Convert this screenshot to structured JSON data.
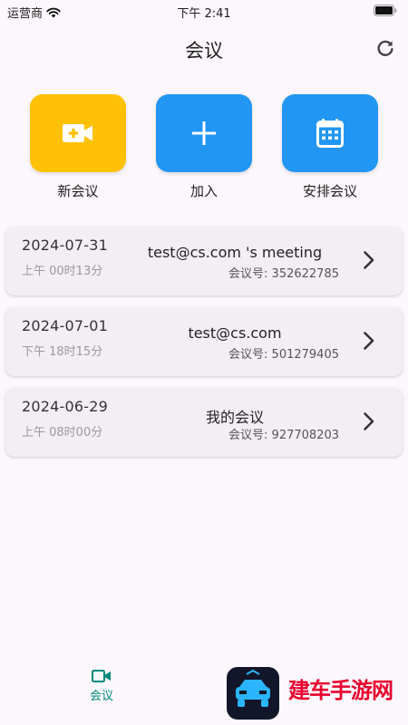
{
  "status_bar": {
    "carrier": "运营商",
    "time": "下午 2:41"
  },
  "header": {
    "title": "会议"
  },
  "actions": [
    {
      "label": "新会议",
      "icon": "video-plus-icon",
      "color": "#ffc107"
    },
    {
      "label": "加入",
      "icon": "plus-icon",
      "color": "#2196f3"
    },
    {
      "label": "安排会议",
      "icon": "calendar-icon",
      "color": "#2196f3"
    }
  ],
  "meetings": [
    {
      "date": "2024-07-31",
      "time": "上午 00时13分",
      "title": "test@cs.com 's meeting",
      "number": "会议号: 352622785"
    },
    {
      "date": "2024-07-01",
      "time": "下午 18时15分",
      "title": "test@cs.com",
      "number": "会议号: 501279405"
    },
    {
      "date": "2024-06-29",
      "time": "上午 08时00分",
      "title": "我的会议",
      "number": "会议号: 927708203"
    }
  ],
  "bottom_nav": {
    "items": [
      {
        "label": "会议",
        "icon": "video-camera-icon",
        "color": "#00897b"
      }
    ]
  },
  "watermark": {
    "text": "建车手游网"
  }
}
